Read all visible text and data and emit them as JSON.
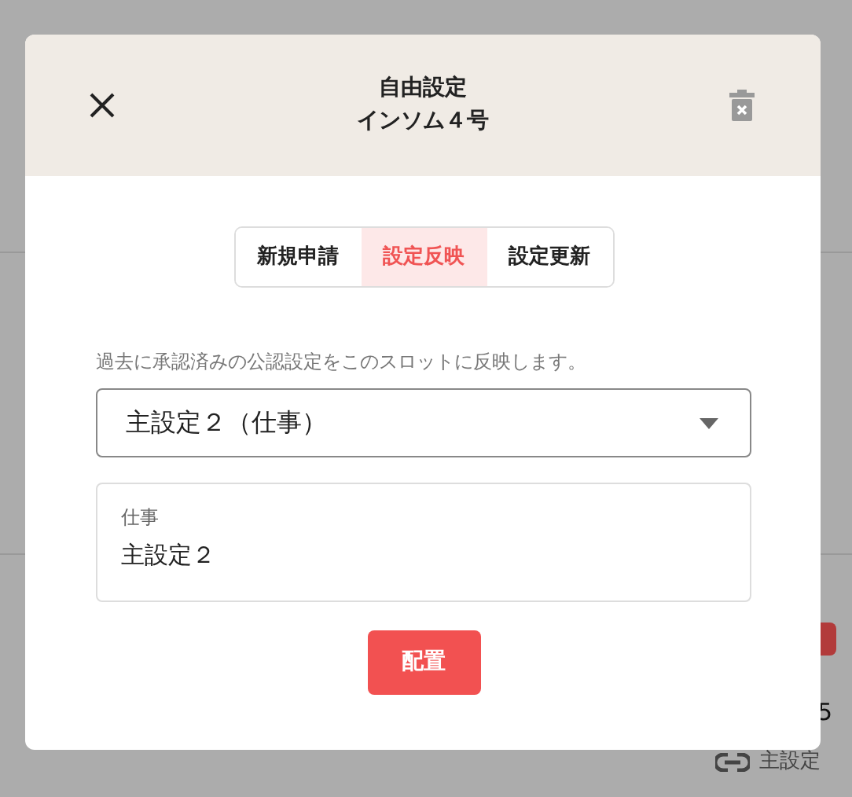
{
  "background": {
    "count": "5",
    "link_label": "主設定"
  },
  "dialog": {
    "title": "自由設定",
    "subtitle": "インソム４号",
    "tabs": [
      {
        "label": "新規申請",
        "selected": false
      },
      {
        "label": "設定反映",
        "selected": true
      },
      {
        "label": "設定更新",
        "selected": false
      }
    ],
    "description": "過去に承認済みの公認設定をこのスロットに反映します。",
    "select": {
      "value": "主設定２（仕事）"
    },
    "preview": {
      "label": "仕事",
      "value": "主設定２"
    },
    "button": "配置"
  }
}
